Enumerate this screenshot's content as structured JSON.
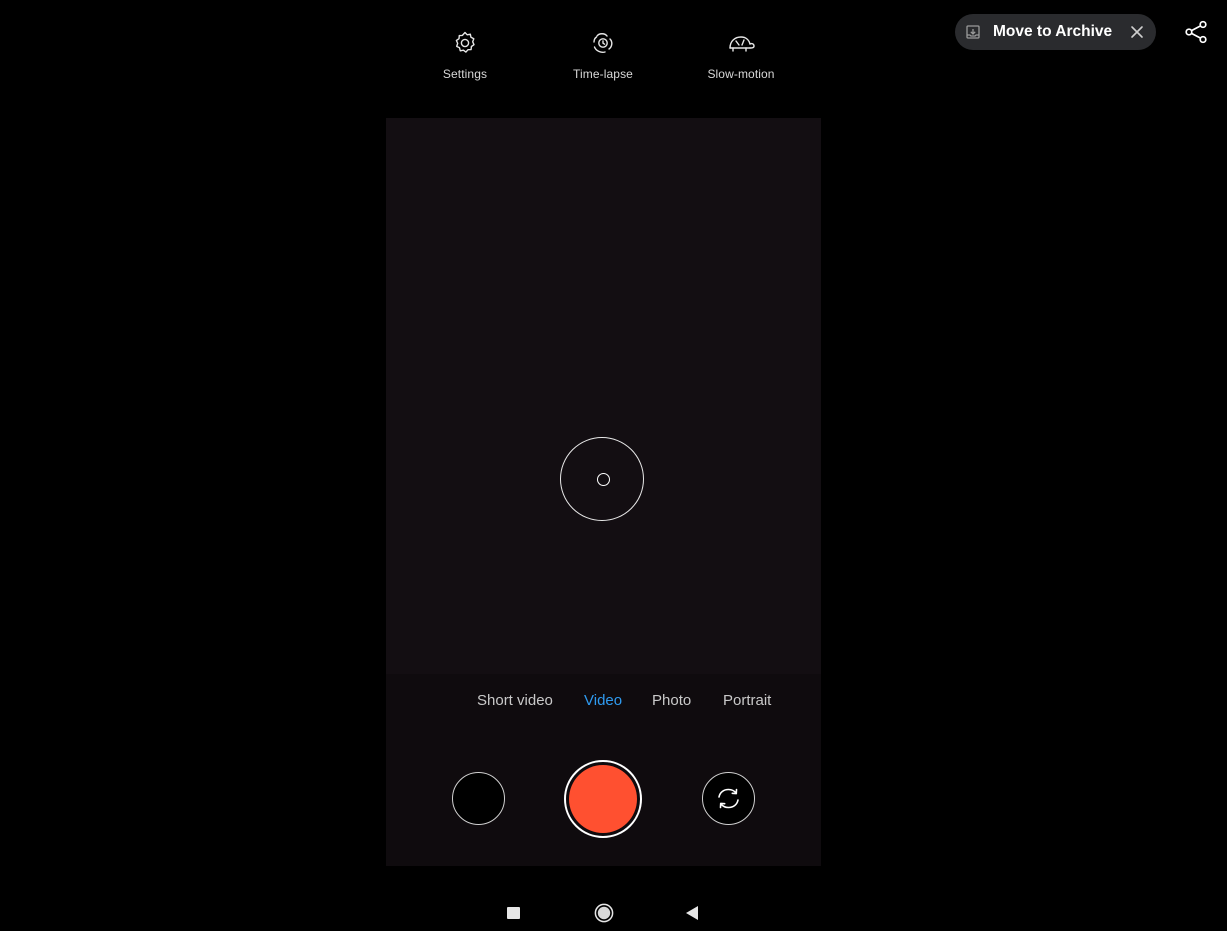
{
  "top_bar": {
    "options": [
      {
        "id": "settings",
        "label": "Settings",
        "icon": "gear-icon"
      },
      {
        "id": "timelapse",
        "label": "Time-lapse",
        "icon": "timelapse-icon"
      },
      {
        "id": "slowmotion",
        "label": "Slow-motion",
        "icon": "turtle-icon"
      }
    ]
  },
  "overlay": {
    "archive_label": "Move to Archive",
    "archive_icon": "archive-icon",
    "close_icon": "close-icon",
    "share_icon": "share-icon"
  },
  "modes": {
    "items": [
      "Short video",
      "Video",
      "Photo",
      "Portrait"
    ],
    "active": "Video",
    "active_color": "#2f9bf0"
  },
  "controls": {
    "record_color": "#ff5030",
    "gallery_icon": "gallery-thumbnail",
    "switch_icon": "switch-camera-icon"
  },
  "nav": {
    "recent_icon": "recents-icon",
    "home_icon": "home-icon",
    "back_icon": "back-icon"
  }
}
